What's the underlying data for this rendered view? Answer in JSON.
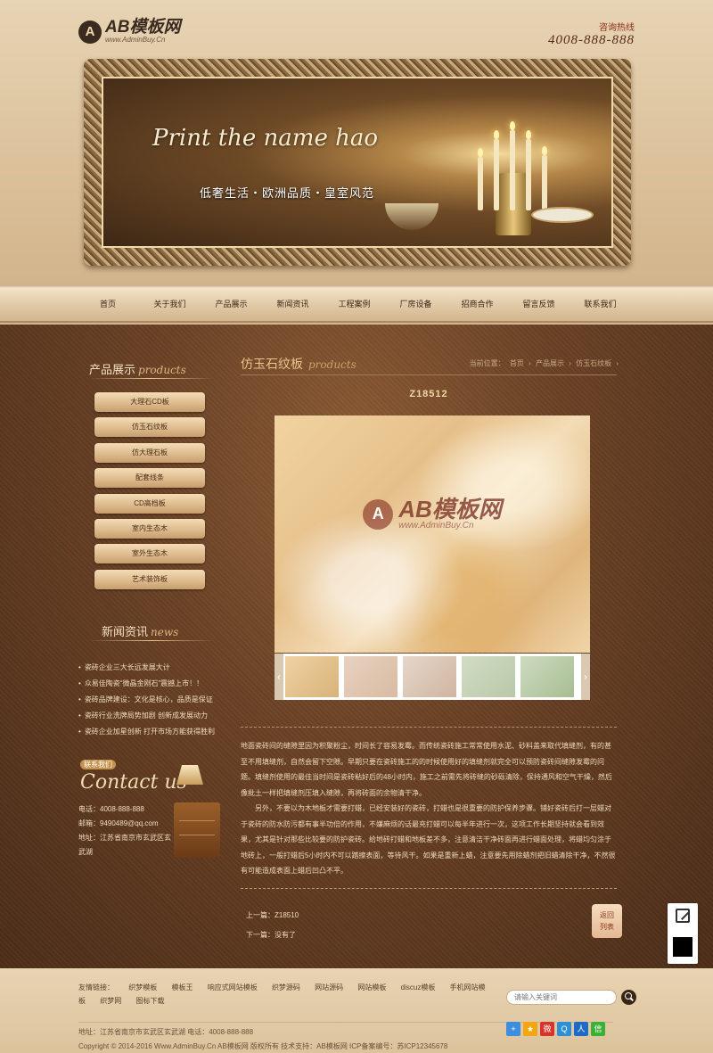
{
  "header": {
    "logo_letter": "A",
    "logo_title": "AB模板网",
    "logo_sub": "www.AdminBuy.Cn",
    "hotline_label": "咨询热线",
    "hotline_number": "4008-888-888"
  },
  "banner": {
    "script_text": "Print the name hao",
    "slogan": "低奢生活・欧洲品质・皇室风范"
  },
  "nav": [
    "首页",
    "关于我们",
    "产品展示",
    "新闻资讯",
    "工程案例",
    "厂房设备",
    "招商合作",
    "留言反馈",
    "联系我们"
  ],
  "sidebar": {
    "products_title": "产品展示",
    "products_script": "products",
    "categories": [
      "大理石CD板",
      "仿玉石纹板",
      "仿大理石板",
      "配套线条",
      "CD高档板",
      "室内生态木",
      "室外生态木",
      "艺术装饰板"
    ],
    "news_title": "新闻资讯",
    "news_script": "news",
    "news": [
      "瓷砖企业三大长远发展大计",
      "众易佳陶瓷“微晶金刚石”震撼上市！！",
      "瓷砖品牌建设：文化是核心，品质是保证",
      "瓷砖行业洗牌局势加剧 创新成发展动力",
      "瓷砖企业加星创新 打开市场方能获得胜利"
    ],
    "contact_badge": "联系我们",
    "contact_script": "Contact us",
    "contact": {
      "phone": "电话：4008-888-888",
      "email": "邮箱：9490489@qq.com",
      "address": "地址：江苏省南京市玄武区玄武湖"
    }
  },
  "content": {
    "title": "仿玉石纹板",
    "title_script": "products",
    "breadcrumb": [
      "当前位置：",
      "首页",
      "›",
      "产品展示",
      "›",
      "仿玉石纹板",
      "›"
    ],
    "product_name": "Z18512",
    "watermark_letter": "A",
    "watermark_title": "AB模板网",
    "watermark_sub": "www.AdminBuy.Cn",
    "thumb_prev": "‹",
    "thumb_next": "›",
    "description": [
      "地面瓷砖间的缝隙里因为积聚粉尘，时间长了容易发霉。而传统瓷砖施工常常使用水泥、砂料盖来取代填缝剂，有的甚至不用填缝剂，自然会留下空隙。早期只要在瓷砖施工的的时候使用好的填缝剂就完全可以预防瓷砖间缝隙发霉的问题。填缝剂使用的最佳当时间是瓷砖粘好后的48小时内，施工之前需先将砖缝的砂砾清除，保持通风和空气干燥，然后像批土一样把填缝剂压填入缝隙，再将砖面的余物清干净。",
      "另外，不要以为木地板才需要打蜡，已经安装好的瓷砖，打蜡也是很重要的防护保养步骤。铺好瓷砖后打一层蜡对于瓷砖的防水防污都有事半功倍的作用，不嫌麻烦的话最充打蜡可以每半年进行一次，这项工作长期坚持就会看到效果，尤其是针对那些比较要的防护瓷砖。给地砖打蜡和地板差不多，注意清洁干净砖面再进行蜡面处理，将蜡均匀涂于地砖上，一般打蜡后5小时内不可以踏擦表面，等待风干。如果是重新上蜡，注意要先用除蜡剂把旧蜡清除干净，不然很有可能造成表面上蜡后凹凸不平。"
    ],
    "prev": "上一篇：Z18510",
    "next": "下一篇：没有了",
    "back_label_1": "返回",
    "back_label_2": "列表"
  },
  "footer": {
    "links_label": "友情链接：",
    "links": [
      "织梦模板",
      "模板王",
      "响应式网站模板",
      "织梦源码",
      "网站源码",
      "网站模板",
      "discuz模板",
      "手机网站模板",
      "织梦网",
      "图标下载"
    ],
    "search_placeholder": "请输入关键词",
    "address_line": "地址：江苏省南京市玄武区玄武湖   电话：4008-888-888",
    "copyright_line": "Copyright © 2014-2016 Www.AdminBuy.Cn AB模板网 版权所有   技术支持：AB模板网   ICP备案编号：苏ICP12345678",
    "share_icons": [
      "+",
      "★",
      "微",
      "Q",
      "人",
      "信"
    ]
  }
}
